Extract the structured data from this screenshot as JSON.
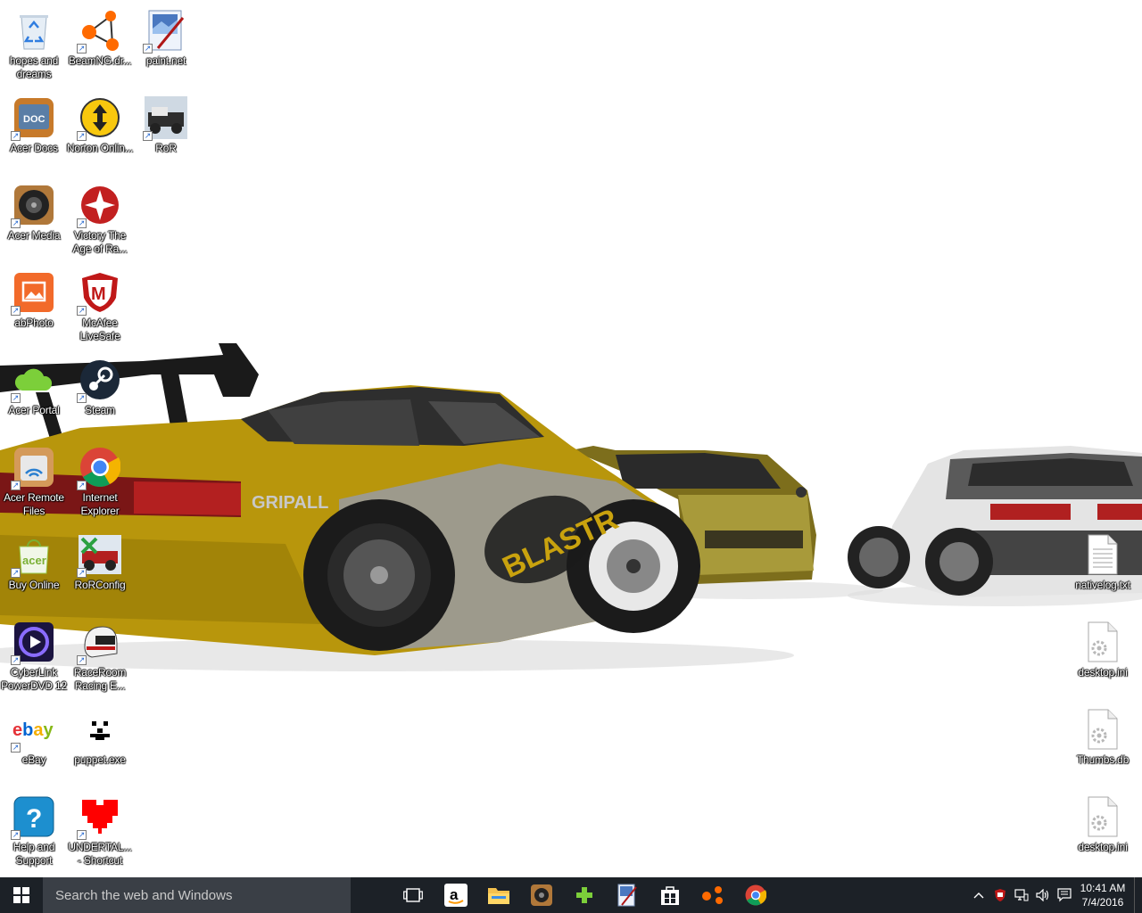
{
  "desktop": {
    "icons": [
      {
        "label": "hopes and dreams",
        "icon": "recycle-bin-icon"
      },
      {
        "label": "BeamNG.dr...",
        "icon": "beamng-icon"
      },
      {
        "label": "paint.net",
        "icon": "paintnet-icon"
      },
      {
        "label": "Acer Docs",
        "icon": "acer-docs-icon"
      },
      {
        "label": "Norton Onlin...",
        "icon": "norton-icon"
      },
      {
        "label": "RoR",
        "icon": "ror-icon"
      },
      {
        "label": "Acer Media",
        "icon": "speaker-icon"
      },
      {
        "label": "Victory The Age of Ra...",
        "icon": "victory-icon"
      },
      {
        "label": "abPhoto",
        "icon": "photo-icon"
      },
      {
        "label": "McAfee LiveSafe",
        "icon": "mcafee-icon"
      },
      {
        "label": "Acer Portal",
        "icon": "cloud-icon"
      },
      {
        "label": "Steam",
        "icon": "steam-icon"
      },
      {
        "label": "Acer Remote Files",
        "icon": "remote-files-icon"
      },
      {
        "label": "Internet Explorer",
        "icon": "chrome-icon"
      },
      {
        "label": "Buy Online",
        "icon": "shopping-bag-icon"
      },
      {
        "label": "RoRConfig",
        "icon": "ror-config-icon"
      },
      {
        "label": "CyberLink PowerDVD 12",
        "icon": "powerdvd-icon"
      },
      {
        "label": "RaceRoom Racing E...",
        "icon": "helmet-icon"
      },
      {
        "label": "eBay",
        "icon": "ebay-icon"
      },
      {
        "label": "puppet.exe",
        "icon": "puppet-icon"
      },
      {
        "label": "Help and Support",
        "icon": "help-icon"
      },
      {
        "label": "UNDERTAL... - Shortcut",
        "icon": "heart-icon"
      },
      {
        "label": "nativelog.txt",
        "icon": "text-file-icon"
      },
      {
        "label": "desktop.ini",
        "icon": "settings-file-icon"
      },
      {
        "label": "Thumbs.db",
        "icon": "settings-file-icon"
      },
      {
        "label": "desktop.ini",
        "icon": "settings-file-icon"
      }
    ],
    "wallpaper_text": {
      "brand1": "BLASTR",
      "brand2": "GRIPALL"
    }
  },
  "taskbar": {
    "search_placeholder": "Search the web and Windows",
    "pinned": [
      "task-view-icon",
      "amazon-icon",
      "file-explorer-icon",
      "media-icon",
      "plus-icon",
      "paintnet-icon",
      "store-icon",
      "beamng-icon",
      "chrome-icon"
    ],
    "clock": {
      "time": "10:41 AM",
      "date": "7/4/2016"
    }
  },
  "colors": {
    "taskbar_bg": "#1c2127",
    "search_bg": "#3a3f46",
    "car_gold": "#b8960c",
    "car_silver": "#9a9a9a"
  }
}
